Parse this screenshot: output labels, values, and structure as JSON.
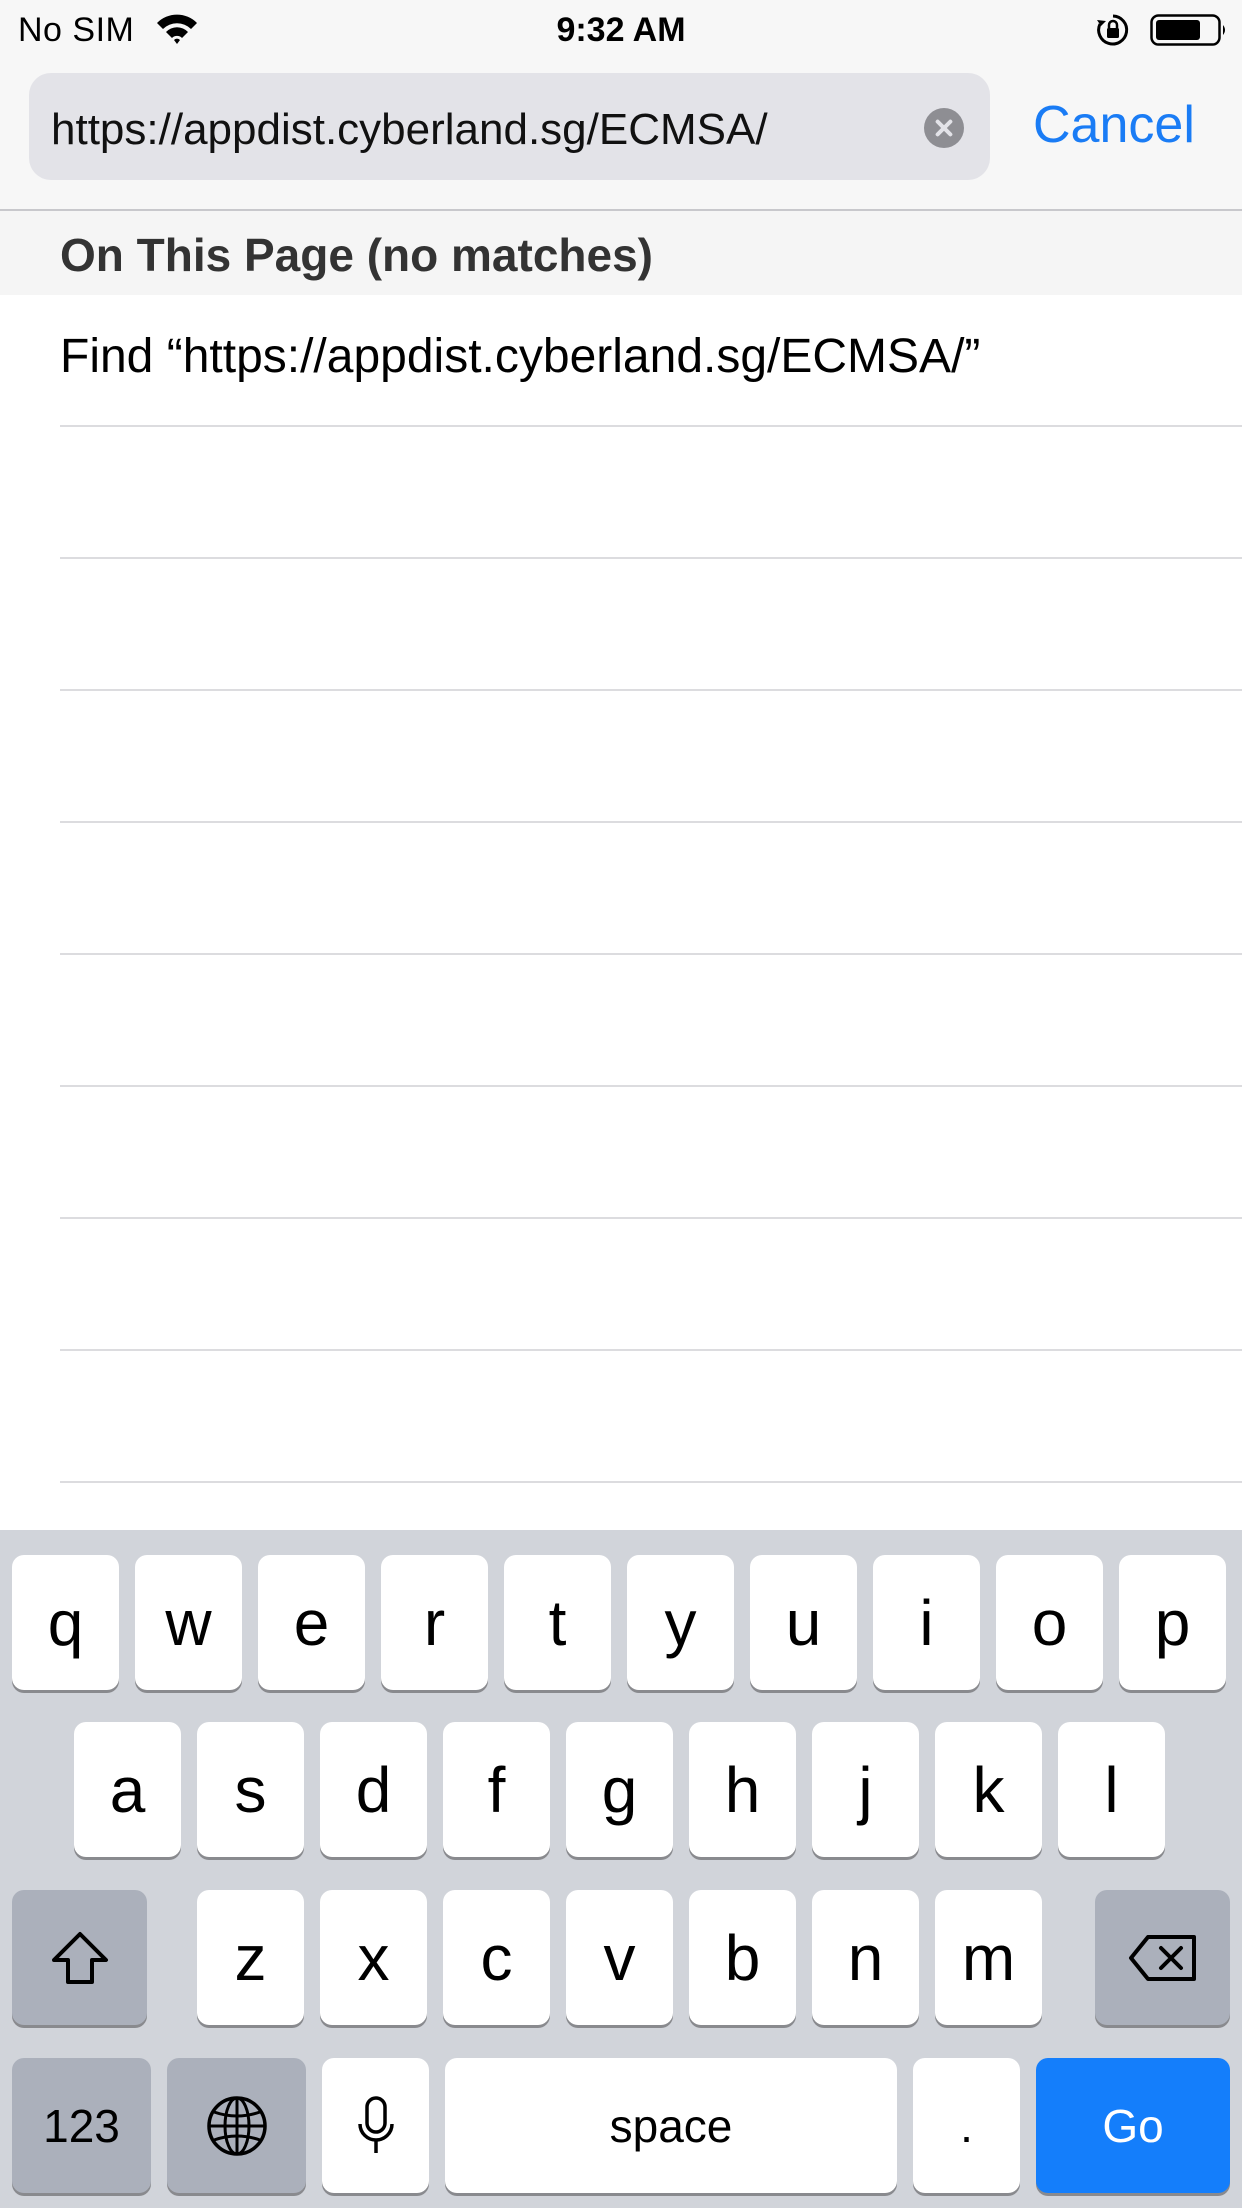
{
  "status_bar": {
    "carrier": "No SIM",
    "time": "9:32 AM"
  },
  "find_bar": {
    "query": "https://appdist.cyberland.sg/ECMSA/",
    "cancel_label": "Cancel"
  },
  "results": {
    "section_title": "On This Page (no matches)",
    "find_row_label": "Find “https://appdist.cyberland.sg/ECMSA/”"
  },
  "keyboard": {
    "row1": [
      "q",
      "w",
      "e",
      "r",
      "t",
      "y",
      "u",
      "i",
      "o",
      "p"
    ],
    "row2": [
      "a",
      "s",
      "d",
      "f",
      "g",
      "h",
      "j",
      "k",
      "l"
    ],
    "row3": [
      "z",
      "x",
      "c",
      "v",
      "b",
      "n",
      "m"
    ],
    "numbers_label": "123",
    "space_label": "space",
    "period_label": ".",
    "go_label": "Go"
  },
  "colors": {
    "accent": "#1a7cf5",
    "go_key": "#147efb",
    "keyboard_bg": "#d1d4da"
  },
  "icons": {
    "status": [
      "wifi-icon",
      "orientation-lock-icon",
      "battery-icon"
    ],
    "keyboard": [
      "shift-icon",
      "delete-icon",
      "globe-icon",
      "microphone-icon"
    ],
    "search": [
      "clear-icon"
    ]
  }
}
